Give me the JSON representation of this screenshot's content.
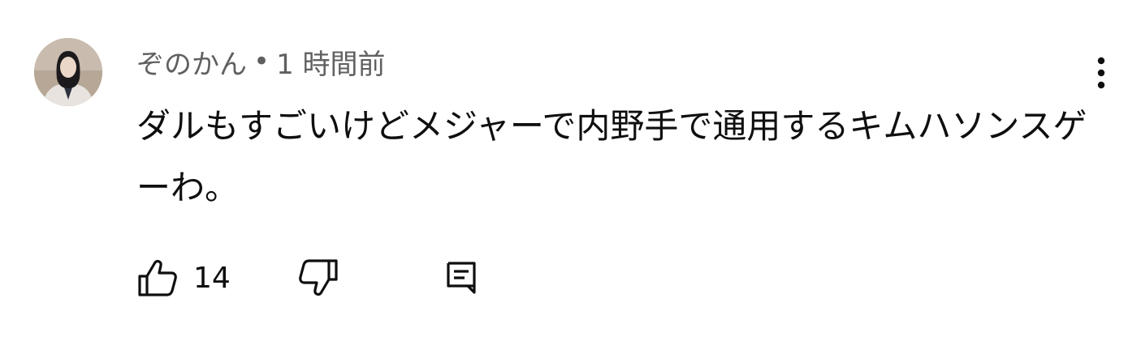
{
  "comment": {
    "author": "ぞのかん",
    "separator": "•",
    "timestamp": "1 時間前",
    "text": "ダルもすごいけどメジャーで内野手で通用するキムハソンスゲーわ。",
    "like_count": "14"
  },
  "icons": {
    "avatar": "user-avatar",
    "menu": "more-vert-icon",
    "like": "thumb-up-icon",
    "dislike": "thumb-down-icon",
    "reply": "comment-reply-icon"
  },
  "colors": {
    "text_primary": "#0f0f0f",
    "text_secondary": "#606060",
    "background": "#ffffff"
  }
}
